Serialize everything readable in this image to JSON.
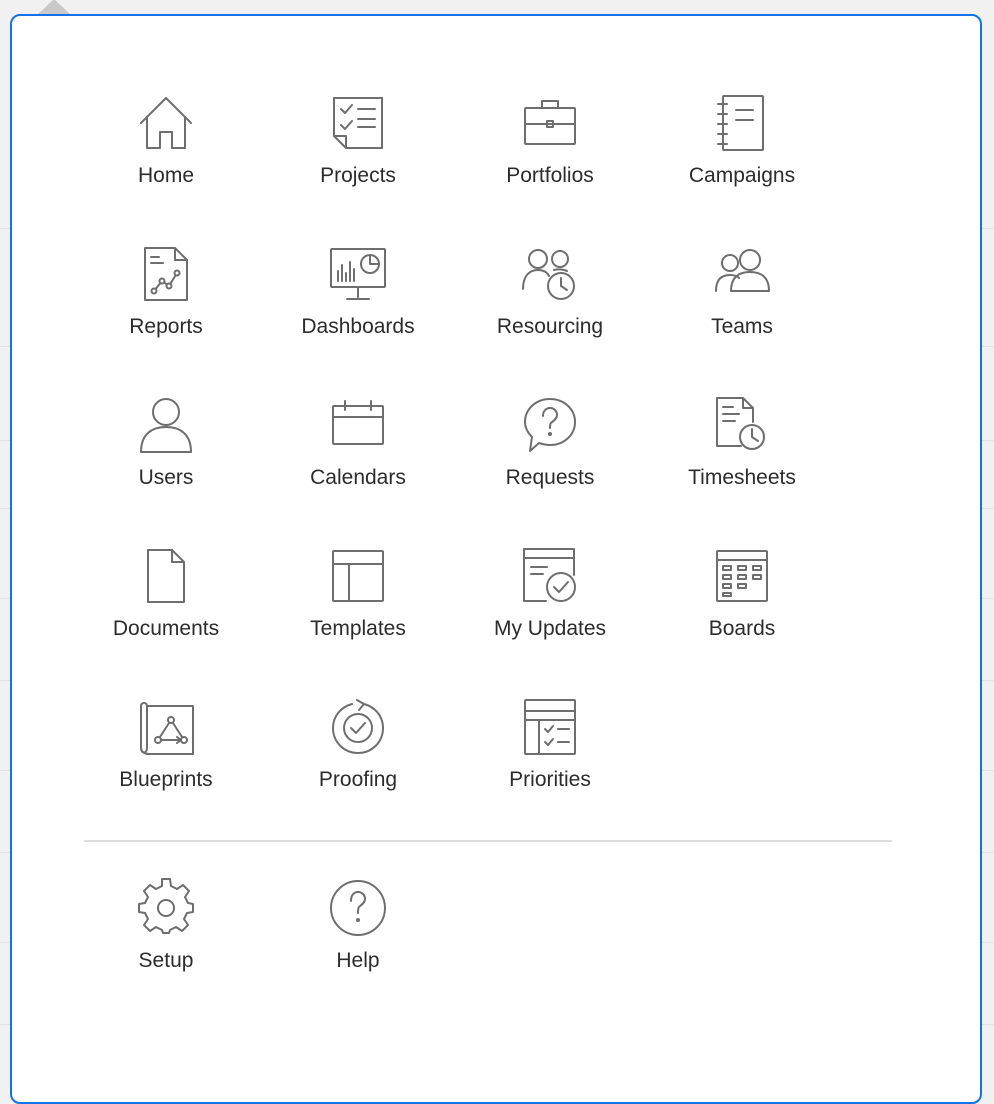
{
  "menu": {
    "items": [
      {
        "key": "home",
        "label": "Home",
        "icon": "home-icon"
      },
      {
        "key": "projects",
        "label": "Projects",
        "icon": "projects-icon"
      },
      {
        "key": "portfolios",
        "label": "Portfolios",
        "icon": "briefcase-icon"
      },
      {
        "key": "campaigns",
        "label": "Campaigns",
        "icon": "notebook-icon"
      },
      {
        "key": "reports",
        "label": "Reports",
        "icon": "report-icon"
      },
      {
        "key": "dashboards",
        "label": "Dashboards",
        "icon": "dashboard-icon"
      },
      {
        "key": "resourcing",
        "label": "Resourcing",
        "icon": "resourcing-icon"
      },
      {
        "key": "teams",
        "label": "Teams",
        "icon": "teams-icon"
      },
      {
        "key": "users",
        "label": "Users",
        "icon": "user-icon"
      },
      {
        "key": "calendars",
        "label": "Calendars",
        "icon": "calendar-icon"
      },
      {
        "key": "requests",
        "label": "Requests",
        "icon": "question-bubble-icon"
      },
      {
        "key": "timesheets",
        "label": "Timesheets",
        "icon": "timesheet-icon"
      },
      {
        "key": "documents",
        "label": "Documents",
        "icon": "document-icon"
      },
      {
        "key": "templates",
        "label": "Templates",
        "icon": "template-icon"
      },
      {
        "key": "my_updates",
        "label": "My Updates",
        "icon": "updates-icon"
      },
      {
        "key": "boards",
        "label": "Boards",
        "icon": "board-icon"
      },
      {
        "key": "blueprints",
        "label": "Blueprints",
        "icon": "blueprint-icon"
      },
      {
        "key": "proofing",
        "label": "Proofing",
        "icon": "proofing-icon"
      },
      {
        "key": "priorities",
        "label": "Priorities",
        "icon": "priorities-icon"
      }
    ],
    "footer_items": [
      {
        "key": "setup",
        "label": "Setup",
        "icon": "gear-icon"
      },
      {
        "key": "help",
        "label": "Help",
        "icon": "help-icon"
      }
    ]
  },
  "colors": {
    "panel_border": "#1473e6",
    "icon_stroke": "#6e6e6e",
    "label_text": "#2c2c2c",
    "divider": "#dcdcdc"
  }
}
